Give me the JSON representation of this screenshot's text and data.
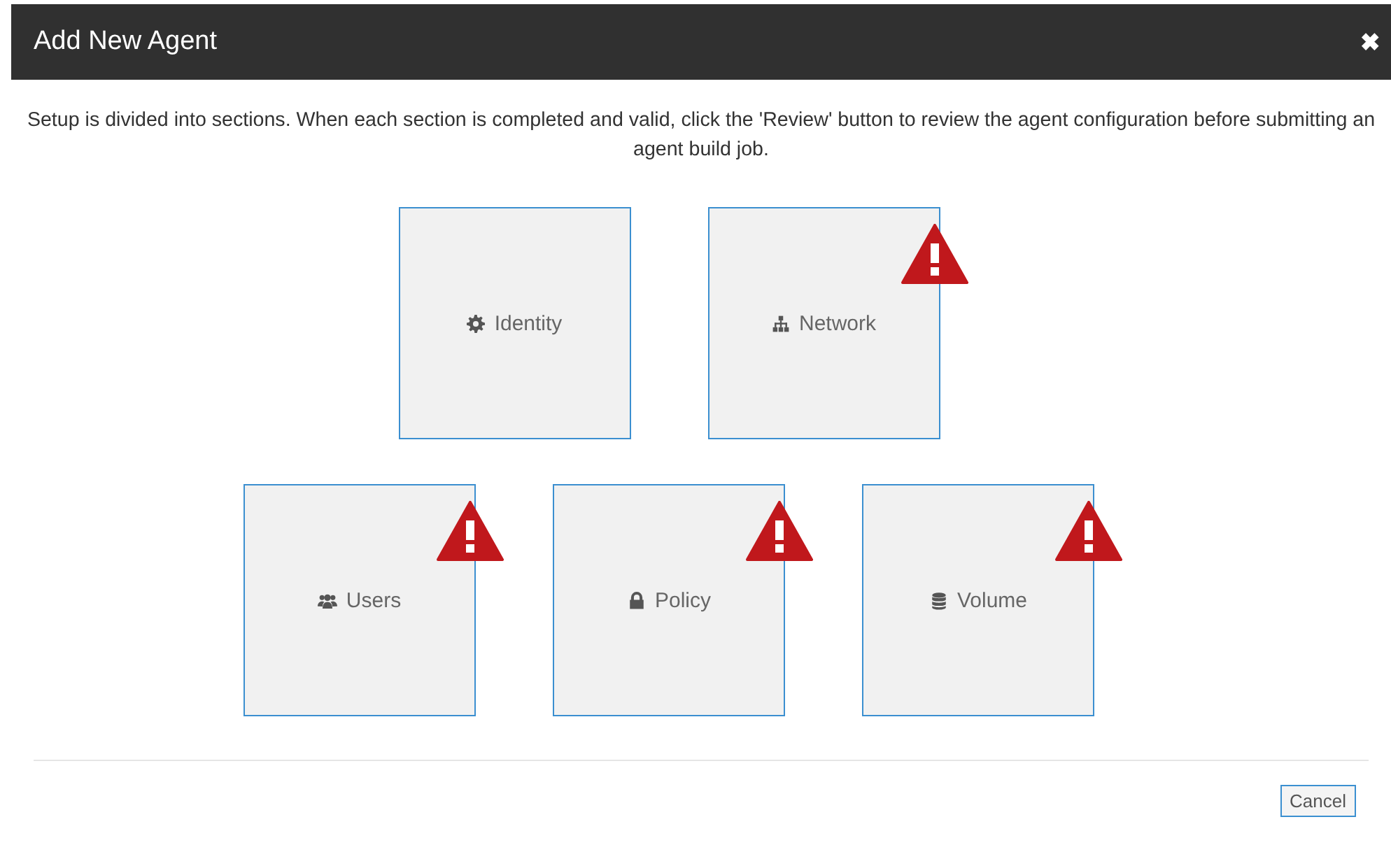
{
  "dialog": {
    "title": "Add New Agent",
    "close_glyph": "✖"
  },
  "intro": "Setup is divided into sections. When each section is completed and valid, click the 'Review' button to review the agent configuration before submitting an agent build job.",
  "section_rows": [
    [
      {
        "label": "Identity",
        "kind": "gear",
        "warning": false
      },
      {
        "label": "Network",
        "kind": "sitemap",
        "warning": true
      }
    ],
    [
      {
        "label": "Users",
        "kind": "users",
        "warning": true
      },
      {
        "label": "Policy",
        "kind": "lock",
        "warning": true
      },
      {
        "label": "Volume",
        "kind": "database",
        "warning": true
      }
    ]
  ],
  "buttons": [
    "Cancel"
  ]
}
